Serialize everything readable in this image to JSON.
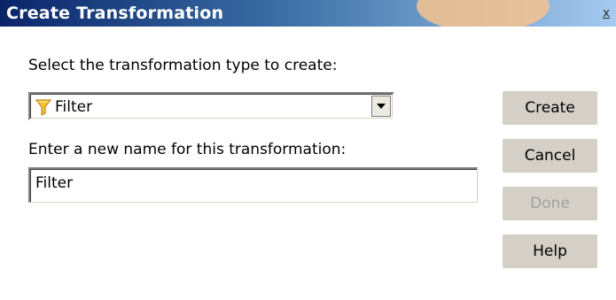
{
  "window": {
    "title": "Create Transformation",
    "close_glyph": "x"
  },
  "labels": {
    "type_prompt": "Select the transformation type to create:",
    "name_prompt": "Enter a new name for this transformation:"
  },
  "type_select": {
    "selected": "Filter",
    "icon": "filter-funnel-icon"
  },
  "name_input": {
    "value": "Filter"
  },
  "buttons": {
    "create": "Create",
    "cancel": "Cancel",
    "done": "Done",
    "help": "Help"
  },
  "colors": {
    "title_bar_start": "#0a246a",
    "title_bar_end": "#a6caf0",
    "button_face": "#d4d0c8",
    "disabled_text": "#a0a0a0"
  }
}
